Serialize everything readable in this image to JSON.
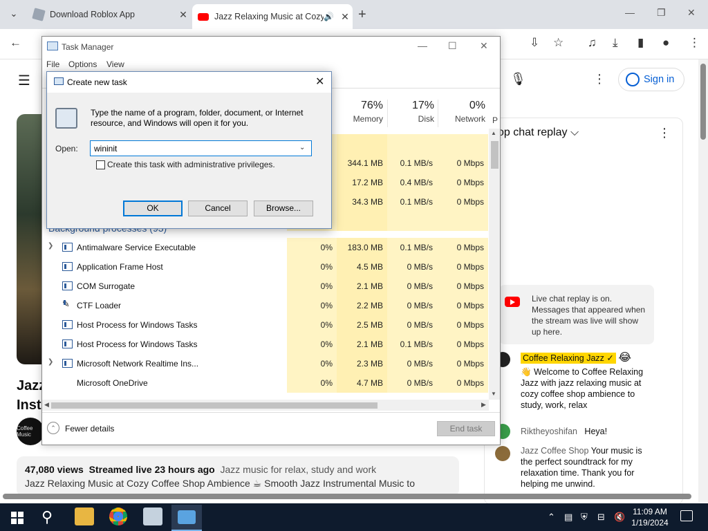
{
  "browser": {
    "tabs": [
      {
        "title": "Download Roblox App",
        "active": false
      },
      {
        "title": "Jazz Relaxing Music at Cozy",
        "active": true
      }
    ]
  },
  "youtube": {
    "sign_in": "Sign in",
    "title_line1": "Jazz",
    "title_line2": "Inst",
    "avatar_text": "Coffee Music",
    "desc_views": "47,080 views",
    "desc_streamed": "Streamed live 23 hours ago",
    "desc_tags": "Jazz music for relax, study and work",
    "desc_line2": "Jazz Relaxing Music at Cozy Coffee Shop Ambience ☕ Smooth Jazz Instrumental Music to",
    "chat_title": "op chat replay ⌵",
    "chat_notice": "Live chat replay is on. Messages that appeared when the stream was live will show up here.",
    "chat_messages": [
      {
        "author": "Coffee Relaxing Jazz ✓",
        "text": "Welcome to Coffee Relaxing Jazz with jazz relaxing music at cozy coffee shop ambience to study, work, relax",
        "highlight": true
      },
      {
        "author": "Riktheyoshifan",
        "text": "Heya!",
        "highlight": false
      },
      {
        "author": "Jazz Coffee Shop",
        "text": "Your music is the perfect soundtrack for my relaxation time. Thank you for helping me unwind.",
        "highlight": false
      }
    ]
  },
  "task_manager": {
    "title": "Task Manager",
    "menu": [
      "File",
      "Options",
      "View"
    ],
    "columns": {
      "memory": {
        "pct": "76%",
        "label": "Memory"
      },
      "disk": {
        "pct": "17%",
        "label": "Disk"
      },
      "network": {
        "pct": "0%",
        "label": "Network"
      },
      "power": "P"
    },
    "app_rows": [
      {
        "mem": "344.1 MB",
        "disk": "0.1 MB/s",
        "net": "0 Mbps"
      },
      {
        "mem": "17.2 MB",
        "disk": "0.4 MB/s",
        "net": "0 Mbps"
      },
      {
        "mem": "34.3 MB",
        "disk": "0.1 MB/s",
        "net": "0 Mbps"
      }
    ],
    "bg_label": "Background processes (93)",
    "processes": [
      {
        "name": "Antimalware Service Executable",
        "cpu": "0%",
        "mem": "183.0 MB",
        "disk": "0.1 MB/s",
        "net": "0 Mbps",
        "expand": true
      },
      {
        "name": "Application Frame Host",
        "cpu": "0%",
        "mem": "4.5 MB",
        "disk": "0 MB/s",
        "net": "0 Mbps",
        "expand": false
      },
      {
        "name": "COM Surrogate",
        "cpu": "0%",
        "mem": "2.1 MB",
        "disk": "0 MB/s",
        "net": "0 Mbps",
        "expand": false
      },
      {
        "name": "CTF Loader",
        "cpu": "0%",
        "mem": "2.2 MB",
        "disk": "0 MB/s",
        "net": "0 Mbps",
        "expand": false
      },
      {
        "name": "Host Process for Windows Tasks",
        "cpu": "0%",
        "mem": "2.5 MB",
        "disk": "0 MB/s",
        "net": "0 Mbps",
        "expand": false
      },
      {
        "name": "Host Process for Windows Tasks",
        "cpu": "0%",
        "mem": "2.1 MB",
        "disk": "0.1 MB/s",
        "net": "0 Mbps",
        "expand": false
      },
      {
        "name": "Microsoft Network Realtime Ins...",
        "cpu": "0%",
        "mem": "2.3 MB",
        "disk": "0 MB/s",
        "net": "0 Mbps",
        "expand": true
      },
      {
        "name": "Microsoft OneDrive",
        "cpu": "0%",
        "mem": "4.7 MB",
        "disk": "0 MB/s",
        "net": "0 Mbps",
        "expand": false
      }
    ],
    "fewer_details": "Fewer details",
    "end_task": "End task"
  },
  "dialog": {
    "title": "Create new task",
    "description": "Type the name of a program, folder, document, or Internet resource, and Windows will open it for you.",
    "open_label": "Open:",
    "open_value": "wininit",
    "admin_label": "Create this task with administrative privileges.",
    "ok": "OK",
    "cancel": "Cancel",
    "browse": "Browse..."
  },
  "taskbar": {
    "time": "11:09 AM",
    "date": "1/19/2024"
  }
}
